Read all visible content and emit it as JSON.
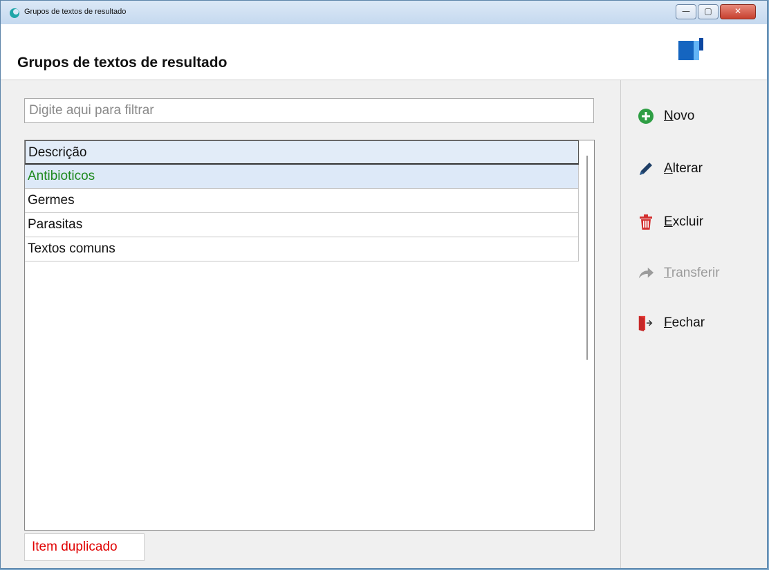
{
  "window": {
    "title": "Grupos de textos de resultado",
    "controls": {
      "minimize": "—",
      "maximize": "▢",
      "close": "✕"
    }
  },
  "header": {
    "title": "Grupos de textos de resultado"
  },
  "filter": {
    "placeholder": "Digite aqui para filtrar",
    "value": ""
  },
  "grid": {
    "column_header": "Descrição",
    "rows": [
      {
        "label": "Antibioticos",
        "selected": true
      },
      {
        "label": "Germes",
        "selected": false
      },
      {
        "label": "Parasitas",
        "selected": false
      },
      {
        "label": "Textos comuns",
        "selected": false
      }
    ]
  },
  "status": {
    "text": "Item duplicado",
    "color": "#e00000"
  },
  "actions": [
    {
      "accel": "N",
      "rest": "ovo",
      "icon": "plus-circle-icon",
      "enabled": true
    },
    {
      "accel": "A",
      "rest": "lterar",
      "icon": "pencil-icon",
      "enabled": true
    },
    {
      "accel": "E",
      "rest": "xcluir",
      "icon": "trash-icon",
      "enabled": true
    },
    {
      "accel": "T",
      "rest": "ransferir",
      "icon": "share-arrow-icon",
      "enabled": false
    },
    {
      "accel": "F",
      "rest": "echar",
      "icon": "exit-door-icon",
      "enabled": true
    }
  ],
  "colors": {
    "selected_row_text": "#1f8a1f",
    "selected_row_bg": "#dde9f8",
    "header_bg": "#e2ecf8",
    "accent_green": "#2e9e44",
    "accent_red": "#d32f2f",
    "pencil": "#1f3f66",
    "disabled": "#9b9b9b"
  }
}
